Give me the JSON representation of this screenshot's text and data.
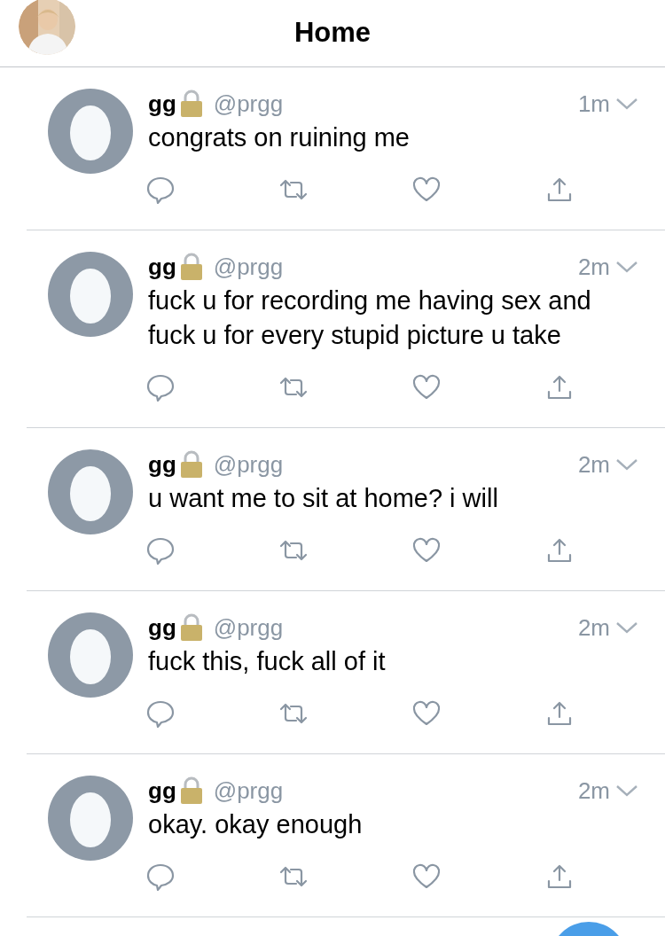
{
  "header": {
    "title": "Home"
  },
  "tweets": [
    {
      "name": "gg",
      "protected": true,
      "handle": "@prgg",
      "time": "1m",
      "text": "congrats on ruining me"
    },
    {
      "name": "gg",
      "protected": true,
      "handle": "@prgg",
      "time": "2m",
      "text": "fuck u for recording me having sex and fuck u for every stupid picture u take"
    },
    {
      "name": "gg",
      "protected": true,
      "handle": "@prgg",
      "time": "2m",
      "text": "u want me to sit at home? i will"
    },
    {
      "name": "gg",
      "protected": true,
      "handle": "@prgg",
      "time": "2m",
      "text": "fuck this, fuck all of it"
    },
    {
      "name": "gg",
      "protected": true,
      "handle": "@prgg",
      "time": "2m",
      "text": "okay. okay enough"
    }
  ]
}
